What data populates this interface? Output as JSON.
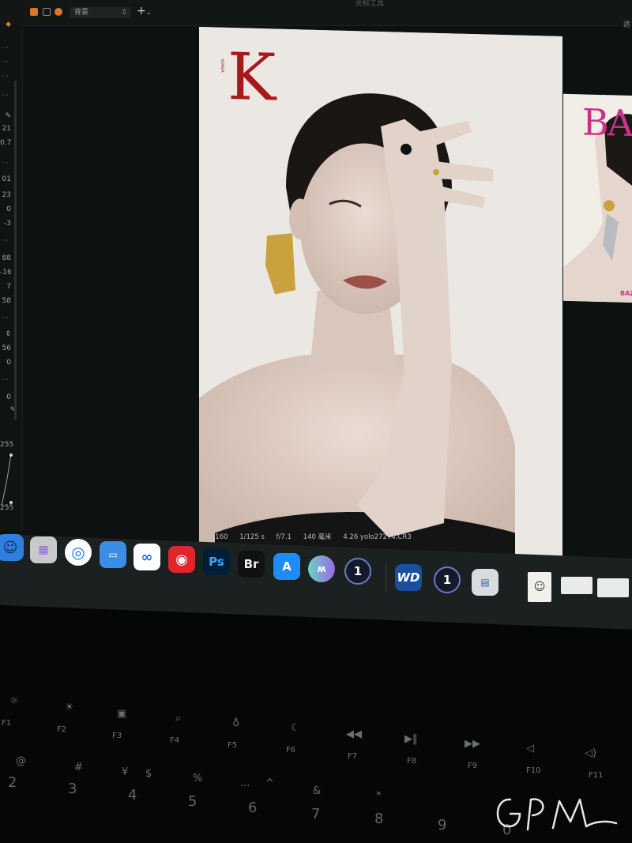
{
  "window": {
    "title": "光标工具",
    "layer_select": "背景",
    "right_label": "适"
  },
  "sidebar": {
    "values": [
      "21",
      "0.7",
      "01",
      "23",
      "0",
      "-3",
      "88",
      "-16",
      "7",
      "58",
      "56",
      "0",
      "0",
      "255",
      "255"
    ]
  },
  "viewer": {
    "magazine_logo": "K",
    "magazine_small": "KOREA"
  },
  "meta": {
    "iso": "ISO 160",
    "shutter": "1/125 s",
    "aperture": "f/7.1",
    "focal": "140 毫米",
    "filename": "4.26 yolo27274.CR3"
  },
  "thumbnail": {
    "logo": "BA",
    "cover_line": "BAZ"
  },
  "dock": {
    "items": [
      {
        "name": "finder-icon",
        "label": "",
        "bg": "#2f7fe0"
      },
      {
        "name": "launchpad-icon",
        "label": "",
        "bg": "#c9c9c9"
      },
      {
        "name": "safari-icon",
        "label": "",
        "bg": "#ffffff"
      },
      {
        "name": "keynote-icon",
        "label": "",
        "bg": "#3a8ee6"
      },
      {
        "name": "baidu-netdisk-icon",
        "label": "",
        "bg": "#ffffff"
      },
      {
        "name": "netease-music-icon",
        "label": "",
        "bg": "#e0262a"
      },
      {
        "name": "photoshop-icon",
        "label": "Ps",
        "bg": "#001e36"
      },
      {
        "name": "bridge-icon",
        "label": "Br",
        "bg": "#111111"
      },
      {
        "name": "app-store-icon",
        "label": "A",
        "bg": "#1d8cf5"
      },
      {
        "name": "meitu-icon",
        "label": "",
        "bg": "#7a6ad8"
      },
      {
        "name": "capture-one-icon",
        "label": "1",
        "bg": "#151a2a"
      },
      {
        "name": "wd-drive-icon",
        "label": "WD",
        "bg": "#1a4fa0"
      },
      {
        "name": "capture-one-alt-icon",
        "label": "1",
        "bg": "#151a2a"
      },
      {
        "name": "preview-icon",
        "label": "",
        "bg": "#d8dce0"
      }
    ]
  },
  "keyboard": {
    "fkeys": [
      "F1",
      "F2",
      "F3",
      "F4",
      "F5",
      "F6",
      "F7",
      "F8",
      "F9",
      "F10",
      "F11"
    ],
    "numbers": [
      "2",
      "3",
      "4",
      "5",
      "6",
      "7",
      "8",
      "9",
      "0"
    ],
    "symbols": [
      "@",
      "#",
      "¥",
      "$",
      "%",
      "...",
      "&",
      "*"
    ]
  },
  "watermark": "GPM"
}
